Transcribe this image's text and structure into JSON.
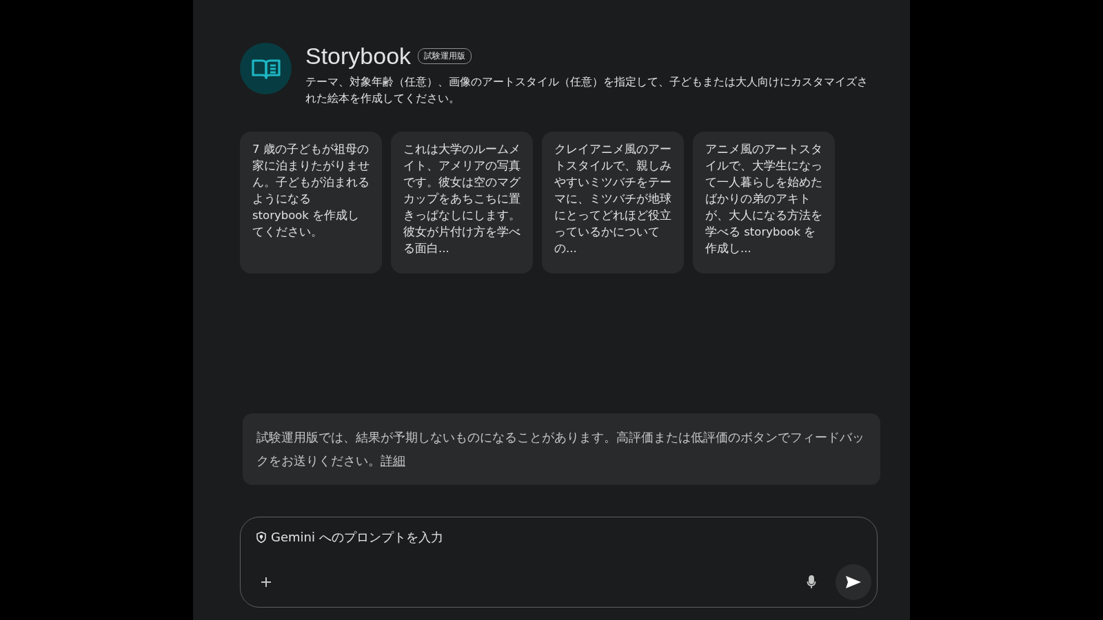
{
  "header": {
    "title": "Storybook",
    "badge": "試験運用版",
    "description": "テーマ、対象年齢（任意）、画像のアートスタイル（任意）を指定して、子どもまたは大人向けにカスタマイズされた絵本を作成してください。"
  },
  "suggestions": [
    {
      "text": "7 歳の子どもが祖母の家に泊まりたがりません。子どもが泊まれるようになる storybook を作成してください。"
    },
    {
      "text": "これは大学のルームメイト、アメリアの写真です。彼女は空のマグカップをあちこちに置きっぱなしにします。彼女が片付け方を学べる面白..."
    },
    {
      "text": "クレイアニメ風のアートスタイルで、親しみやすいミツバチをテーマに、ミツバチが地球にとってどれほど役立っているかについての..."
    },
    {
      "text": "アニメ風のアートスタイルで、大学生になって一人暮らしを始めたばかりの弟のアキトが、大人になる方法を学べる storybook を作成し..."
    }
  ],
  "notice": {
    "text": "試験運用版では、結果が予期しないものになることがあります。高評価または低評価のボタンでフィードバックをお送りください。",
    "link": "詳細"
  },
  "prompt": {
    "placeholder": "Gemini へのプロンプトを入力"
  }
}
